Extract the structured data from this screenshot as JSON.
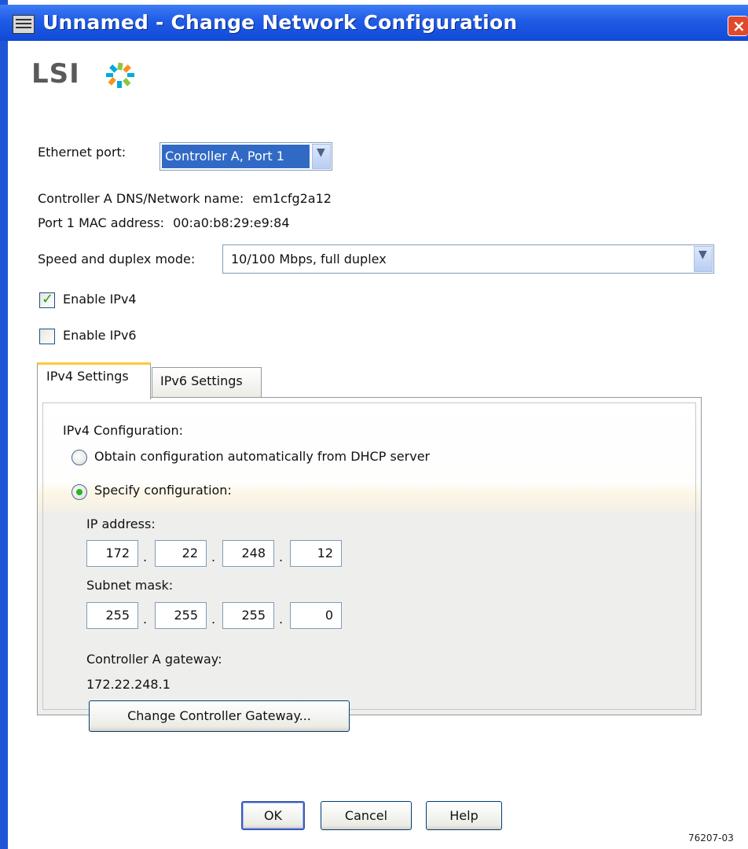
{
  "window": {
    "title": "Unnamed - Change Network Configuration"
  },
  "logo": {
    "text": "LSI"
  },
  "ethernet_port": {
    "label": "Ethernet port:",
    "selected": "Controller A, Port 1"
  },
  "info": {
    "dns_label": "Controller A DNS/Network name:",
    "dns_value": "em1cfg2a12",
    "mac_label": "Port 1 MAC address:",
    "mac_value": "00:a0:b8:29:e9:84"
  },
  "speed": {
    "label": "Speed and duplex mode:",
    "selected": "10/100 Mbps, full duplex"
  },
  "enable_ipv4": {
    "label": "Enable IPv4",
    "checked": true
  },
  "enable_ipv6": {
    "label": "Enable IPv6",
    "checked": false
  },
  "tabs": [
    {
      "label": "IPv4 Settings",
      "active": true
    },
    {
      "label": "IPv6 Settings",
      "active": false
    }
  ],
  "ipv4": {
    "section_label": "IPv4 Configuration:",
    "option_dhcp": "Obtain configuration automatically from DHCP server",
    "option_specify": "Specify configuration:",
    "selected_option": "specify",
    "ip_label": "IP address:",
    "ip": [
      "172",
      "22",
      "248",
      "12"
    ],
    "subnet_label": "Subnet mask:",
    "subnet": [
      "255",
      "255",
      "255",
      "0"
    ],
    "gateway_label": "Controller A gateway:",
    "gateway_value": "172.22.248.1",
    "gateway_button": "Change Controller Gateway..."
  },
  "buttons": {
    "ok": "OK",
    "cancel": "Cancel",
    "help": "Help"
  },
  "figure_id": "76207-03",
  "colors": {
    "title_bar": "#1f5be6",
    "selection": "#316ac5",
    "check": "#21a121",
    "tab_highlight": "#ffc83c"
  },
  "icons": [
    "window-menu-icon",
    "close-icon",
    "lsi-logo-icon",
    "chevron-down-icon",
    "checkmark-icon"
  ]
}
